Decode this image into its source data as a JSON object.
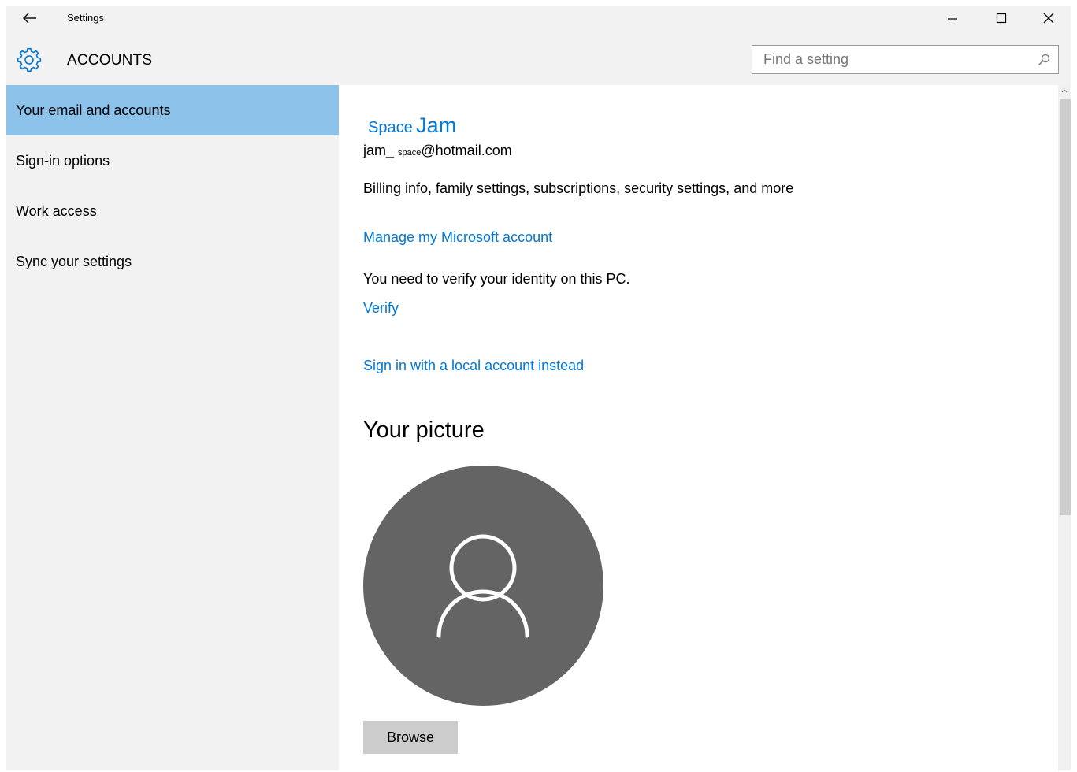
{
  "window": {
    "title": "Settings",
    "controls": {
      "minimize": "minimize-icon",
      "maximize": "maximize-icon",
      "close": "close-icon"
    }
  },
  "header": {
    "section_title": "ACCOUNTS",
    "icon": "gear-icon"
  },
  "search": {
    "placeholder": "Find a setting",
    "icon": "search-icon"
  },
  "sidebar": {
    "items": [
      {
        "label": "Your email and accounts",
        "active": true
      },
      {
        "label": "Sign-in options",
        "active": false
      },
      {
        "label": "Work access",
        "active": false
      },
      {
        "label": "Sync your settings",
        "active": false
      }
    ]
  },
  "account": {
    "first_name": "Space",
    "last_name": "Jam",
    "email_prefix": "jam_",
    "email_middle": "space",
    "email_suffix": "@hotmail.com",
    "billing_text": "Billing info, family settings, subscriptions, security settings, and more",
    "manage_link": "Manage my Microsoft account",
    "verify_text": "You need to verify your identity on this PC.",
    "verify_link": "Verify",
    "local_account_link": "Sign in with a local account instead"
  },
  "picture": {
    "heading": "Your picture",
    "avatar_icon": "user-icon",
    "browse_label": "Browse"
  },
  "colors": {
    "accent": "#0078d7",
    "sidebar_active": "#8dc3ea",
    "sidebar_bg": "#f2f2f2",
    "avatar_bg": "#646464",
    "button_bg": "#cccccc"
  }
}
